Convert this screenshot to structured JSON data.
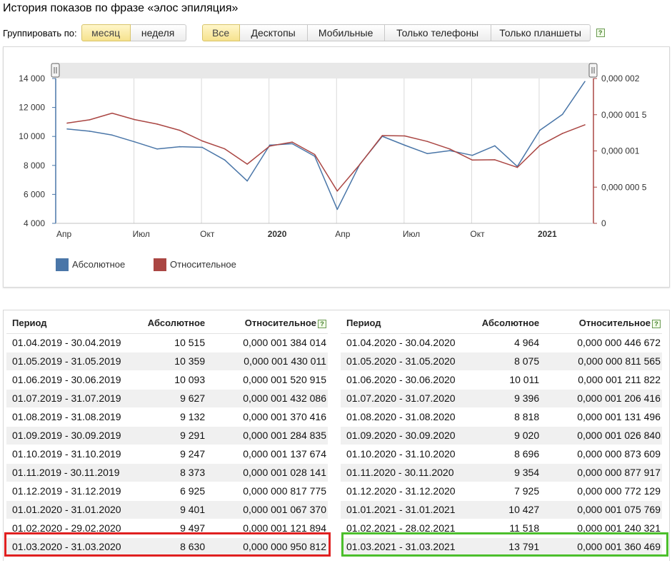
{
  "page": {
    "title": "История показов по фразе «элос эпиляция»"
  },
  "toolbar": {
    "group_label": "Группировать по:",
    "group_options": [
      "месяц",
      "неделя"
    ],
    "device_options": [
      "Все",
      "Десктопы",
      "Мобильные",
      "Только телефоны",
      "Только планшеты"
    ],
    "help": "?"
  },
  "colors": {
    "absolute": "#4a76a8",
    "relative": "#aa4643",
    "highlight_left": "#e02020",
    "highlight_right": "#4cbf2c",
    "active_button": "#f6e28d"
  },
  "chart_data": {
    "type": "line",
    "x": [
      "2019-04",
      "2019-05",
      "2019-06",
      "2019-07",
      "2019-08",
      "2019-09",
      "2019-10",
      "2019-11",
      "2019-12",
      "2020-01",
      "2020-02",
      "2020-03",
      "2020-04",
      "2020-05",
      "2020-06",
      "2020-07",
      "2020-08",
      "2020-09",
      "2020-10",
      "2020-11",
      "2020-12",
      "2021-01",
      "2021-02",
      "2021-03"
    ],
    "x_tick_labels": [
      "Апр",
      "Июл",
      "Окт",
      "2020",
      "Апр",
      "Июл",
      "Окт",
      "2021"
    ],
    "x_tick_positions": [
      "2019-04",
      "2019-07",
      "2019-10",
      "2020-01",
      "2020-04",
      "2020-07",
      "2020-10",
      "2021-01"
    ],
    "x_tick_bold": [
      false,
      false,
      false,
      true,
      false,
      false,
      false,
      true
    ],
    "y_left": {
      "ylim": [
        4000,
        14000
      ],
      "ticks": [
        "4 000",
        "6 000",
        "8 000",
        "10 000",
        "12 000",
        "14 000"
      ]
    },
    "y_right": {
      "ylim": [
        0,
        2e-06
      ],
      "ticks": [
        "0",
        "0,000 000 5",
        "0,000 001",
        "0,000 001 5",
        "0,000 002"
      ]
    },
    "series": [
      {
        "name": "Абсолютное",
        "axis": "left",
        "color": "#4a76a8",
        "values": [
          10515,
          10359,
          10093,
          9627,
          9132,
          9291,
          9247,
          8373,
          6925,
          9401,
          9497,
          8630,
          4964,
          8075,
          10011,
          9396,
          8818,
          9020,
          8696,
          9354,
          7925,
          10427,
          11518,
          13791
        ]
      },
      {
        "name": "Относительное",
        "axis": "right",
        "color": "#aa4643",
        "values": [
          1.384014e-06,
          1.430011e-06,
          1.520915e-06,
          1.432086e-06,
          1.370416e-06,
          1.284835e-06,
          1.137674e-06,
          1.028141e-06,
          8.17775e-07,
          1.06737e-06,
          1.121894e-06,
          9.50812e-07,
          4.46672e-07,
          8.11565e-07,
          1.211822e-06,
          1.206416e-06,
          1.131496e-06,
          1.02684e-06,
          8.73609e-07,
          8.77917e-07,
          7.72129e-07,
          1.075769e-06,
          1.240321e-06,
          1.360469e-06
        ]
      }
    ],
    "legend_position": "bottom-left",
    "grid": "vertical"
  },
  "table": {
    "headers": {
      "period": "Период",
      "absolute": "Абсолютное",
      "relative": "Относительное"
    },
    "left": [
      [
        "01.04.2019 - 30.04.2019",
        "10 515",
        "0,000 001 384 014"
      ],
      [
        "01.05.2019 - 31.05.2019",
        "10 359",
        "0,000 001 430 011"
      ],
      [
        "01.06.2019 - 30.06.2019",
        "10 093",
        "0,000 001 520 915"
      ],
      [
        "01.07.2019 - 31.07.2019",
        "9 627",
        "0,000 001 432 086"
      ],
      [
        "01.08.2019 - 31.08.2019",
        "9 132",
        "0,000 001 370 416"
      ],
      [
        "01.09.2019 - 30.09.2019",
        "9 291",
        "0,000 001 284 835"
      ],
      [
        "01.10.2019 - 31.10.2019",
        "9 247",
        "0,000 001 137 674"
      ],
      [
        "01.11.2019 - 30.11.2019",
        "8 373",
        "0,000 001 028 141"
      ],
      [
        "01.12.2019 - 31.12.2019",
        "6 925",
        "0,000 000 817 775"
      ],
      [
        "01.01.2020 - 31.01.2020",
        "9 401",
        "0,000 001 067 370"
      ],
      [
        "01.02.2020 - 29.02.2020",
        "9 497",
        "0,000 001 121 894"
      ],
      [
        "01.03.2020 - 31.03.2020",
        "8 630",
        "0,000 000 950 812"
      ]
    ],
    "right": [
      [
        "01.04.2020 - 30.04.2020",
        "4 964",
        "0,000 000 446 672"
      ],
      [
        "01.05.2020 - 31.05.2020",
        "8 075",
        "0,000 000 811 565"
      ],
      [
        "01.06.2020 - 30.06.2020",
        "10 011",
        "0,000 001 211 822"
      ],
      [
        "01.07.2020 - 31.07.2020",
        "9 396",
        "0,000 001 206 416"
      ],
      [
        "01.08.2020 - 31.08.2020",
        "8 818",
        "0,000 001 131 496"
      ],
      [
        "01.09.2020 - 30.09.2020",
        "9 020",
        "0,000 001 026 840"
      ],
      [
        "01.10.2020 - 31.10.2020",
        "8 696",
        "0,000 000 873 609"
      ],
      [
        "01.11.2020 - 30.11.2020",
        "9 354",
        "0,000 000 877 917"
      ],
      [
        "01.12.2020 - 31.12.2020",
        "7 925",
        "0,000 000 772 129"
      ],
      [
        "01.01.2021 - 31.01.2021",
        "10 427",
        "0,000 001 075 769"
      ],
      [
        "01.02.2021 - 28.02.2021",
        "11 518",
        "0,000 001 240 321"
      ],
      [
        "01.03.2021 - 31.03.2021",
        "13 791",
        "0,000 001 360 469"
      ]
    ]
  }
}
